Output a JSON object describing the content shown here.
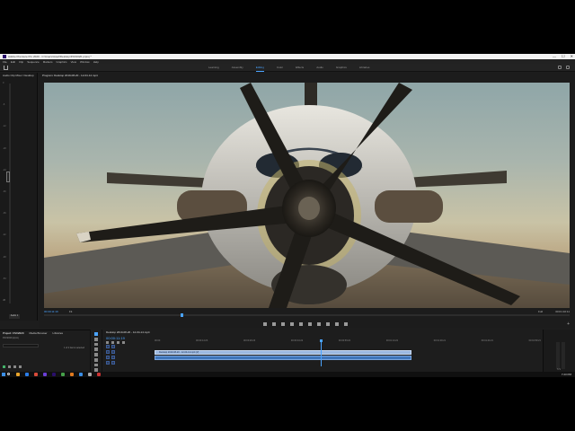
{
  "window": {
    "title": "Adobe Premiere Pro 2020 - C:\\Users\\Josef\\Desktop\\FSX2020.prproj *",
    "controls": [
      "—",
      "☐",
      "✕"
    ]
  },
  "menu": [
    "File",
    "Edit",
    "Clip",
    "Sequence",
    "Markers",
    "Graphics",
    "View",
    "Window",
    "Help"
  ],
  "workspaces": {
    "items": [
      "Learning",
      "Assembly",
      "Editing",
      "Color",
      "Effects",
      "Audio",
      "Graphics",
      "Libraries"
    ],
    "active": "Editing"
  },
  "left_panel": {
    "tab": "Audio Clip Mixer: Desktop",
    "scale": [
      "0",
      "-6",
      "-12",
      "-18",
      "-24",
      "-30",
      "-36",
      "-42",
      "-48",
      "-54",
      "dB"
    ],
    "bottom": "Audio 1"
  },
  "program": {
    "tab": "Program: Desktop 2019-08-20 - 12-04-14.mp4",
    "timecode": "00:00:11:19",
    "zoom": "Fit",
    "resolution": "Full",
    "duration": "00:01:10:11",
    "playhead": 0.26
  },
  "project": {
    "tabs": [
      "Project: FSX2020",
      "Media Browser",
      "Libraries"
    ],
    "active_tab": "Project: FSX2020",
    "path": "FSX2020.prproj",
    "items": "1 of 2 items selected"
  },
  "timeline": {
    "tab": "Desktop 2019-08-20 - 12-04-14.mp4",
    "timecode": "00:00:11:19",
    "ruler": [
      "00:00",
      "00:00:14:23",
      "00:00:29:23",
      "00:00:44:22",
      "00:00:59:22",
      "00:01:14:22",
      "00:01:29:21",
      "00:01:44:21",
      "00:01:59:21"
    ],
    "video_clip": "Desktop 2019-08-20 - 12-04-14.mp4 [V]",
    "playhead": 0.43
  },
  "right_meters": {
    "label": "S S"
  },
  "taskbar": {
    "time": "7:23 PM",
    "app_colors": [
      "#e9a42b",
      "#2b7de9",
      "#d94b3a",
      "#6b3fd6",
      "#2a0f6b",
      "#45a049",
      "#e07a1f",
      "#3a8ee6",
      "#aaaaaa",
      "#cc3333"
    ]
  },
  "colors": {
    "accent": "#4aa3ff",
    "clip_video": "#9bb8e0",
    "clip_audio": "#3f76bb"
  }
}
